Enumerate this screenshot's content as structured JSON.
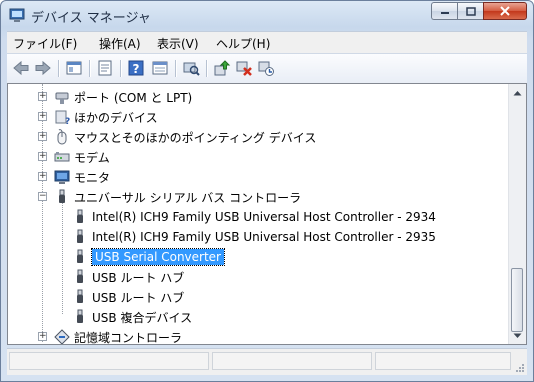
{
  "window": {
    "title": "デバイス マネージャ"
  },
  "menu": [
    "ファイル(F)",
    "操作(A)",
    "表示(V)",
    "ヘルプ(H)"
  ],
  "toolbar": [
    "back-icon",
    "forward-icon",
    "show-hide-tree-icon",
    "properties-icon",
    "help-icon",
    "view-icon",
    "scan-hardware-icon",
    "update-driver-icon",
    "uninstall-icon",
    "disable-icon"
  ],
  "tree": {
    "items": [
      {
        "label": "ポート (COM と LPT)",
        "icon": "port-icon",
        "expander": "+"
      },
      {
        "label": "ほかのデバイス",
        "icon": "unknown-device-icon",
        "expander": "+"
      },
      {
        "label": "マウスとそのほかのポインティング デバイス",
        "icon": "mouse-icon",
        "expander": "+"
      },
      {
        "label": "モデム",
        "icon": "modem-icon",
        "expander": "+"
      },
      {
        "label": "モニタ",
        "icon": "monitor-icon",
        "expander": "+"
      },
      {
        "label": "ユニバーサル シリアル バス コントローラ",
        "icon": "usb-icon",
        "expander": "−"
      },
      {
        "label": "Intel(R) ICH9 Family USB Universal Host Controller - 2934",
        "icon": "usb-icon"
      },
      {
        "label": "Intel(R) ICH9 Family USB Universal Host Controller - 2935",
        "icon": "usb-icon"
      },
      {
        "label": "USB Serial Converter",
        "icon": "usb-icon",
        "selected": true
      },
      {
        "label": "USB ルート ハブ",
        "icon": "usb-icon"
      },
      {
        "label": "USB ルート ハブ",
        "icon": "usb-icon"
      },
      {
        "label": "USB 複合デバイス",
        "icon": "usb-icon"
      },
      {
        "label": "記憶域コントローラ",
        "icon": "storage-controller-icon",
        "expander": "+"
      }
    ]
  },
  "colors": {
    "selection": "#3399ff",
    "accent": "#1e2d44"
  }
}
